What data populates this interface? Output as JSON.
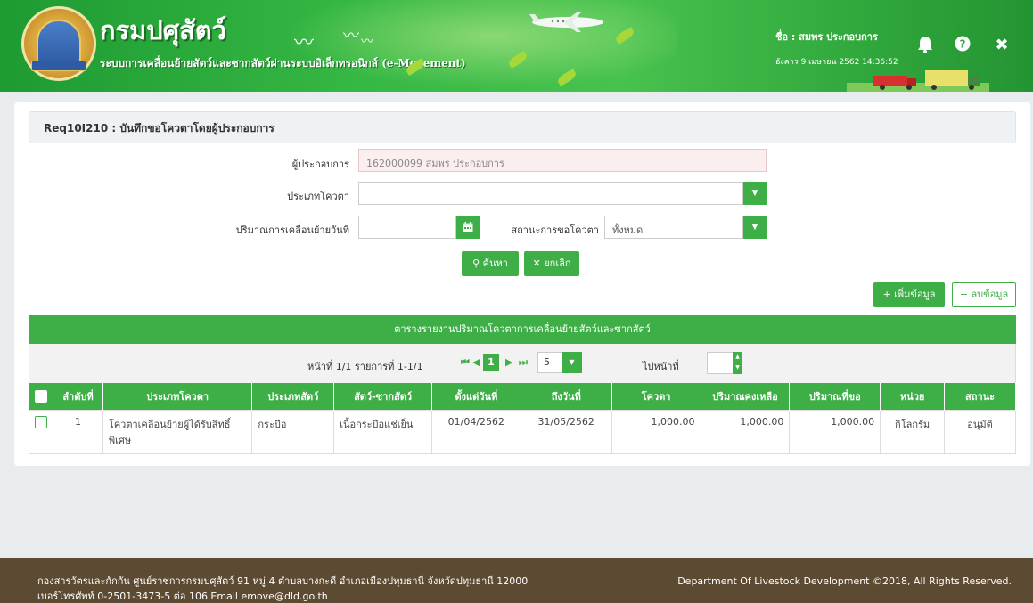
{
  "header": {
    "title": "กรมปศุสัตว์",
    "subtitle": "ระบบการเคลื่อนย้ายสัตว์และซากสัตว์ผ่านระบบอิเล็กทรอนิกส์ (e-Movement)",
    "user_label": "ชื่อ : สมพร ประกอบการ",
    "datetime": "อังคาร 9 เมษายน 2562 14:36:52",
    "icons": [
      "bell-icon",
      "help-icon",
      "close-icon"
    ]
  },
  "form": {
    "title": "Req10I210 : บันทึกขอโควตาโดยผู้ประกอบการ",
    "operator_label": "ผู้ประกอบการ",
    "operator_value": "162000099 สมพร ประกอบการ",
    "quota_type_label": "ประเภทโควตา",
    "quota_type_value": "",
    "move_date_label": "ปริมาณการเคลื่อนย้ายวันที่",
    "move_date_value": "",
    "status_label": "สถานะการขอโควตา",
    "status_value": "ทั้งหมด",
    "search_button": "ค้นหา",
    "cancel_button": "ยกเลิก",
    "add_button": "เพิ่มข้อมูล",
    "delete_button": "ลบข้อมูล"
  },
  "grid": {
    "caption": "ตารางรายงานปริมาณโควตาการเคลื่อนย้ายสัตว์และซากสัตว์",
    "pager": {
      "info": "หน้าที่ 1/1 รายการที่ 1-1/1",
      "current_page": "1",
      "page_size": "5",
      "goto_label": "ไปหน้าที่"
    },
    "columns": [
      "ลำดับที่",
      "ประเภทโควตา",
      "ประเภทสัตว์",
      "สัตว์-ซากสัตว์",
      "ตั้งแต่วันที่",
      "ถึงวันที่",
      "โควตา",
      "ปริมาณคงเหลือ",
      "ปริมาณที่ขอ",
      "หน่วย",
      "สถานะ"
    ],
    "rows": [
      {
        "no": "1",
        "quota_type": "โควตาเคลื่อนย้ายผู้ได้รับสิทธิ์พิเศษ",
        "animal_type": "กระบือ",
        "carcass": "เนื้อกระบือแช่เย็น",
        "from": "01/04/2562",
        "to": "31/05/2562",
        "quota": "1,000.00",
        "remaining": "1,000.00",
        "requested": "1,000.00",
        "unit": "กิโลกรัม",
        "status": "อนุมัติ"
      }
    ]
  },
  "footer": {
    "address_line1": "กองสารวัตรและกักกัน ศูนย์ราชการกรมปศุสัตว์ 91 หมู่ 4 ตำบลบางกะดี อำเภอเมืองปทุมธานี จังหวัดปทุมธานี 12000",
    "address_line2": "เบอร์โทรศัพท์ 0-2501-3473-5 ต่อ 106 Email emove@dld.go.th",
    "copyright": "Department Of Livestock Development ©2018, All Rights Reserved."
  },
  "colors": {
    "primary_green": "#3eae47",
    "footer_brown": "#5c4a32",
    "readonly_pink": "#fbeeee"
  }
}
